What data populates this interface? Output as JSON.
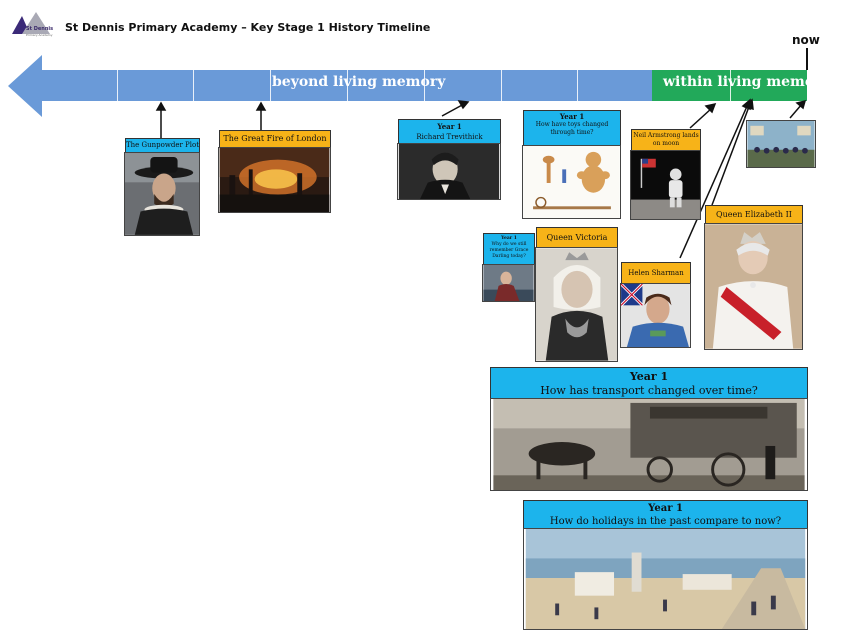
{
  "header": {
    "logo_name": "St Dennis",
    "logo_sub": "Primary Academy",
    "title": "St Dennis Primary Academy – Key Stage 1 History Timeline",
    "now_label": "now"
  },
  "timeline": {
    "past_label": "beyond living memory",
    "recent_label": "within living memory",
    "past_color": "#6a9ad8",
    "recent_color": "#22a95a"
  },
  "events": {
    "gunpowder": {
      "title": "The Gunpowder Plot"
    },
    "fire": {
      "title": "The Great Fire of London"
    },
    "trevithick": {
      "year": "Year 1",
      "title": "Richard Trevithick"
    },
    "toys": {
      "year": "Year 1",
      "title": "How have toys changed through time?"
    },
    "armstrong": {
      "title": "Neil Armstrong lands on moon"
    },
    "darling": {
      "year": "Year 1",
      "title": "Why do we still remember Grace Darling today?"
    },
    "victoria": {
      "title": "Queen Victoria"
    },
    "sharman": {
      "title": "Helen Sharman"
    },
    "elizabeth": {
      "title": "Queen Elizabeth II"
    },
    "transport": {
      "year": "Year 1",
      "title": "How has transport changed over time?"
    },
    "holidays": {
      "year": "Year 1",
      "title": "How do holidays in the past compare to now?"
    }
  },
  "colors": {
    "caption_blue": "#1cb4ec",
    "caption_orange": "#f7b318"
  }
}
